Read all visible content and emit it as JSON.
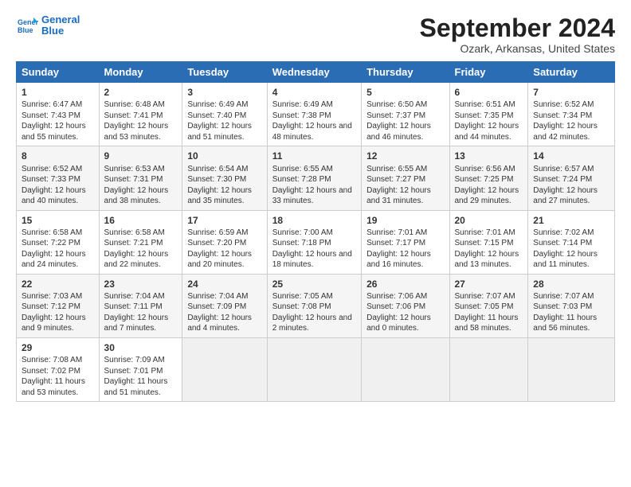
{
  "header": {
    "logo_line1": "General",
    "logo_line2": "Blue",
    "main_title": "September 2024",
    "subtitle": "Ozark, Arkansas, United States"
  },
  "days_of_week": [
    "Sunday",
    "Monday",
    "Tuesday",
    "Wednesday",
    "Thursday",
    "Friday",
    "Saturday"
  ],
  "weeks": [
    [
      {
        "day": "1",
        "sunrise": "6:47 AM",
        "sunset": "7:43 PM",
        "daylight": "12 hours and 55 minutes."
      },
      {
        "day": "2",
        "sunrise": "6:48 AM",
        "sunset": "7:41 PM",
        "daylight": "12 hours and 53 minutes."
      },
      {
        "day": "3",
        "sunrise": "6:49 AM",
        "sunset": "7:40 PM",
        "daylight": "12 hours and 51 minutes."
      },
      {
        "day": "4",
        "sunrise": "6:49 AM",
        "sunset": "7:38 PM",
        "daylight": "12 hours and 48 minutes."
      },
      {
        "day": "5",
        "sunrise": "6:50 AM",
        "sunset": "7:37 PM",
        "daylight": "12 hours and 46 minutes."
      },
      {
        "day": "6",
        "sunrise": "6:51 AM",
        "sunset": "7:35 PM",
        "daylight": "12 hours and 44 minutes."
      },
      {
        "day": "7",
        "sunrise": "6:52 AM",
        "sunset": "7:34 PM",
        "daylight": "12 hours and 42 minutes."
      }
    ],
    [
      {
        "day": "8",
        "sunrise": "6:52 AM",
        "sunset": "7:33 PM",
        "daylight": "12 hours and 40 minutes."
      },
      {
        "day": "9",
        "sunrise": "6:53 AM",
        "sunset": "7:31 PM",
        "daylight": "12 hours and 38 minutes."
      },
      {
        "day": "10",
        "sunrise": "6:54 AM",
        "sunset": "7:30 PM",
        "daylight": "12 hours and 35 minutes."
      },
      {
        "day": "11",
        "sunrise": "6:55 AM",
        "sunset": "7:28 PM",
        "daylight": "12 hours and 33 minutes."
      },
      {
        "day": "12",
        "sunrise": "6:55 AM",
        "sunset": "7:27 PM",
        "daylight": "12 hours and 31 minutes."
      },
      {
        "day": "13",
        "sunrise": "6:56 AM",
        "sunset": "7:25 PM",
        "daylight": "12 hours and 29 minutes."
      },
      {
        "day": "14",
        "sunrise": "6:57 AM",
        "sunset": "7:24 PM",
        "daylight": "12 hours and 27 minutes."
      }
    ],
    [
      {
        "day": "15",
        "sunrise": "6:58 AM",
        "sunset": "7:22 PM",
        "daylight": "12 hours and 24 minutes."
      },
      {
        "day": "16",
        "sunrise": "6:58 AM",
        "sunset": "7:21 PM",
        "daylight": "12 hours and 22 minutes."
      },
      {
        "day": "17",
        "sunrise": "6:59 AM",
        "sunset": "7:20 PM",
        "daylight": "12 hours and 20 minutes."
      },
      {
        "day": "18",
        "sunrise": "7:00 AM",
        "sunset": "7:18 PM",
        "daylight": "12 hours and 18 minutes."
      },
      {
        "day": "19",
        "sunrise": "7:01 AM",
        "sunset": "7:17 PM",
        "daylight": "12 hours and 16 minutes."
      },
      {
        "day": "20",
        "sunrise": "7:01 AM",
        "sunset": "7:15 PM",
        "daylight": "12 hours and 13 minutes."
      },
      {
        "day": "21",
        "sunrise": "7:02 AM",
        "sunset": "7:14 PM",
        "daylight": "12 hours and 11 minutes."
      }
    ],
    [
      {
        "day": "22",
        "sunrise": "7:03 AM",
        "sunset": "7:12 PM",
        "daylight": "12 hours and 9 minutes."
      },
      {
        "day": "23",
        "sunrise": "7:04 AM",
        "sunset": "7:11 PM",
        "daylight": "12 hours and 7 minutes."
      },
      {
        "day": "24",
        "sunrise": "7:04 AM",
        "sunset": "7:09 PM",
        "daylight": "12 hours and 4 minutes."
      },
      {
        "day": "25",
        "sunrise": "7:05 AM",
        "sunset": "7:08 PM",
        "daylight": "12 hours and 2 minutes."
      },
      {
        "day": "26",
        "sunrise": "7:06 AM",
        "sunset": "7:06 PM",
        "daylight": "12 hours and 0 minutes."
      },
      {
        "day": "27",
        "sunrise": "7:07 AM",
        "sunset": "7:05 PM",
        "daylight": "11 hours and 58 minutes."
      },
      {
        "day": "28",
        "sunrise": "7:07 AM",
        "sunset": "7:03 PM",
        "daylight": "11 hours and 56 minutes."
      }
    ],
    [
      {
        "day": "29",
        "sunrise": "7:08 AM",
        "sunset": "7:02 PM",
        "daylight": "11 hours and 53 minutes."
      },
      {
        "day": "30",
        "sunrise": "7:09 AM",
        "sunset": "7:01 PM",
        "daylight": "11 hours and 51 minutes."
      },
      null,
      null,
      null,
      null,
      null
    ]
  ],
  "labels": {
    "sunrise": "Sunrise:",
    "sunset": "Sunset:",
    "daylight": "Daylight:"
  }
}
